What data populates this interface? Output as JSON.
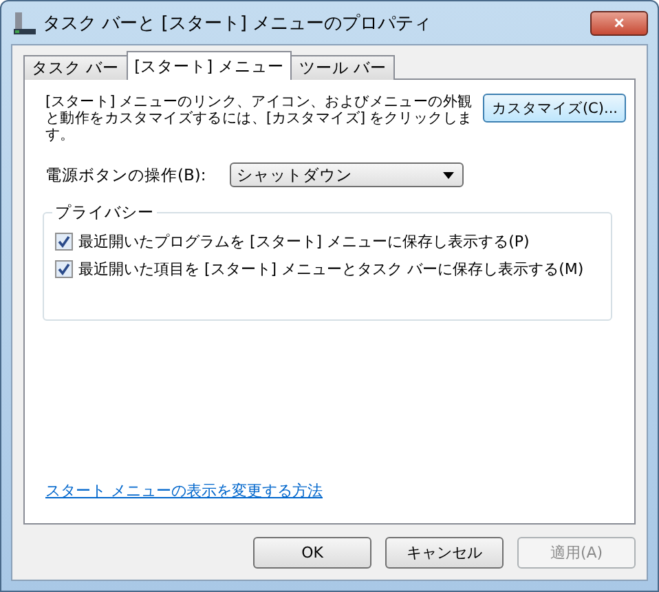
{
  "window": {
    "title": "タスク バーと [スタート] メニューのプロパティ",
    "close": "×"
  },
  "tabs": [
    {
      "label": "タスク バー",
      "selected": false
    },
    {
      "label": "[スタート] メニュー",
      "selected": true
    },
    {
      "label": "ツール バー",
      "selected": false
    }
  ],
  "description": "[スタート] メニューのリンク、アイコン、およびメニューの外観と動作をカスタマイズするには、[カスタマイズ] をクリックします。",
  "customize_button": "カスタマイズ(C)...",
  "power_button": {
    "label": "電源ボタンの操作(B):",
    "value": "シャットダウン"
  },
  "privacy": {
    "title": "プライバシー",
    "options": [
      {
        "label": "最近開いたプログラムを [スタート] メニューに保存し表示する(P)",
        "checked": true
      },
      {
        "label": "最近開いた項目を [スタート] メニューとタスク バーに保存し表示する(M)",
        "checked": true
      }
    ]
  },
  "help_link": "スタート メニューの表示を変更する方法",
  "buttons": [
    {
      "label": "OK",
      "disabled": false
    },
    {
      "label": "キャンセル",
      "disabled": false
    },
    {
      "label": "適用(A)",
      "disabled": true
    }
  ]
}
